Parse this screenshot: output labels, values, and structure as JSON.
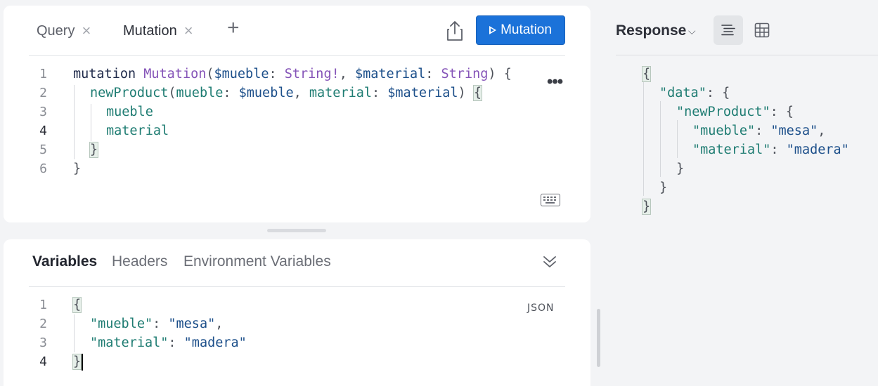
{
  "tabs": [
    {
      "label": "Query",
      "close": "×"
    },
    {
      "label": "Mutation",
      "close": "×"
    }
  ],
  "add_tab": "+",
  "run_button": {
    "label": "Mutation"
  },
  "editor": {
    "line_numbers": [
      "1",
      "2",
      "3",
      "4",
      "5",
      "6"
    ],
    "line1": {
      "kw": "mutation ",
      "name": "Mutation",
      "p1": "(",
      "v1": "$mueble",
      "c1": ": ",
      "t1": "String!",
      "sep": ", ",
      "v2": "$material",
      "c2": ": ",
      "t2": "String",
      "end": ") {"
    },
    "line2": {
      "fn": "newProduct",
      "p1": "(",
      "a1": "mueble",
      "c1": ": ",
      "v1": "$mueble",
      "sep": ", ",
      "a2": "material",
      "c2": ": ",
      "v2": "$material",
      "p2": ") ",
      "brace": "{"
    },
    "line3": "mueble",
    "line4": "material",
    "line5": "}",
    "line6": "}",
    "more_glyph": "•••"
  },
  "variables_panel": {
    "tabs": [
      "Variables",
      "Headers",
      "Environment Variables"
    ],
    "format_label": "JSON",
    "line_numbers": [
      "1",
      "2",
      "3",
      "4"
    ],
    "open_brace": "{",
    "k1": "\"mueble\"",
    "v1": "\"mesa\"",
    "k2": "\"material\"",
    "v2": "\"madera\"",
    "close_brace": "}"
  },
  "response": {
    "title": "Response",
    "chevron": "⌵",
    "l1": "{",
    "k_data": "\"data\"",
    "k_new": "\"newProduct\"",
    "k_mueble": "\"mueble\"",
    "v_mueble": "\"mesa\"",
    "k_material": "\"material\"",
    "v_material": "\"madera\"",
    "c1": "}",
    "c2": "}",
    "c3": "}"
  }
}
